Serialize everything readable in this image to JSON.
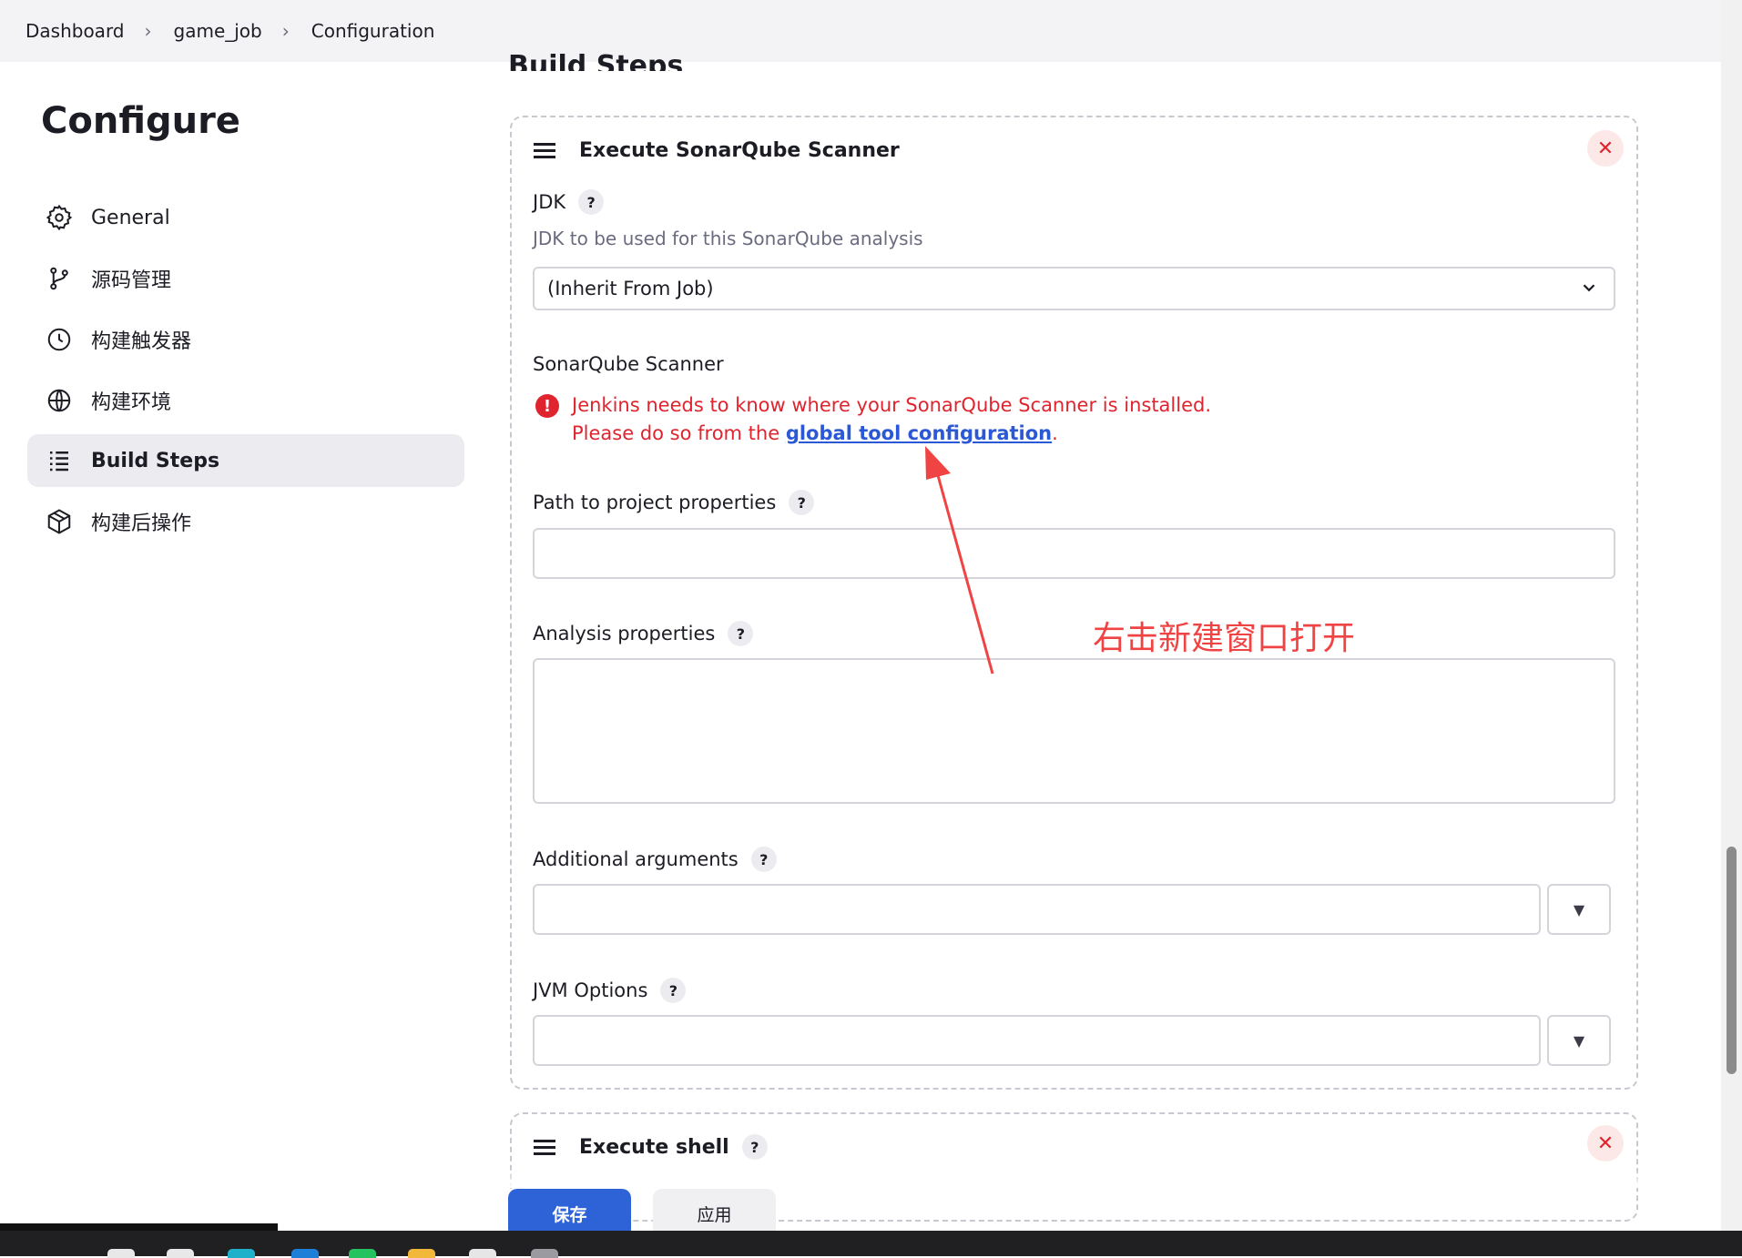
{
  "breadcrumb": [
    "Dashboard",
    "game_job",
    "Configuration"
  ],
  "sidebar": {
    "title": "Configure",
    "items": [
      {
        "label": "General",
        "icon": "gear-icon"
      },
      {
        "label": "源码管理",
        "icon": "branch-icon"
      },
      {
        "label": "构建触发器",
        "icon": "clock-icon"
      },
      {
        "label": "构建环境",
        "icon": "globe-icon"
      },
      {
        "label": "Build Steps",
        "icon": "list-icon",
        "active": true
      },
      {
        "label": "构建后操作",
        "icon": "package-icon"
      }
    ]
  },
  "section_title": "Build Steps",
  "sonar_step": {
    "title": "Execute SonarQube Scanner",
    "jdk_label": "JDK",
    "jdk_desc": "JDK to be used for this SonarQube analysis",
    "jdk_value": "(Inherit From Job)",
    "scanner_label": "SonarQube Scanner",
    "error_line1": "Jenkins needs to know where your SonarQube Scanner is installed.",
    "error_line2_prefix": "Please do so from the ",
    "error_link": "global tool configuration",
    "error_line2_suffix": ".",
    "path_label": "Path to project properties",
    "path_value": "",
    "analysis_label": "Analysis properties",
    "analysis_value": "",
    "args_label": "Additional arguments",
    "args_value": "",
    "jvm_label": "JVM Options",
    "jvm_value": ""
  },
  "shell_step": {
    "title": "Execute shell"
  },
  "help_glyph": "?",
  "close_glyph": "✕",
  "dropdown_glyph": "▼",
  "annotation": "右击新建窗口打开",
  "buttons": {
    "save": "保存",
    "apply": "应用"
  },
  "colors": {
    "accent": "#2e63d8",
    "error": "#e0242e",
    "annotation": "#f04444"
  }
}
